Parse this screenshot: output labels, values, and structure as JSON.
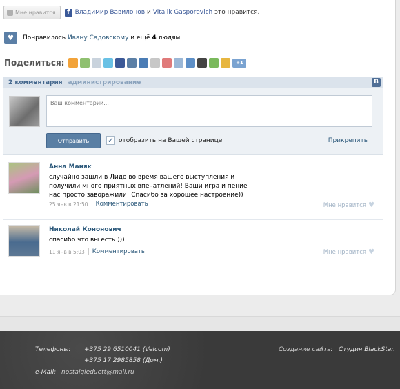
{
  "like_bar": {
    "button_label": "Мне нравится",
    "fb_user1": "Владимир Вавилонов",
    "and": "и",
    "fb_user2": "Vitalik Gasporevich",
    "suffix": "это нравится."
  },
  "vk_like": {
    "prefix": "Понравилось",
    "user": "Ивану Садовскому",
    "middle": "и ещё",
    "count": "4",
    "suffix": "людям"
  },
  "share": {
    "label": "Поделиться:",
    "icons": [
      "rss-icon",
      "share-icon",
      "mail-icon",
      "twitter-icon",
      "facebook-icon",
      "vkontakte-icon",
      "myworld-icon",
      "odnoklassniki-icon",
      "livejournal-icon",
      "liveinternet-icon",
      "mailru-icon",
      "delicious-icon",
      "googlebuzz-icon",
      "windows-live-icon",
      "google-plus-icon"
    ],
    "plus_label": "+1"
  },
  "comments_widget": {
    "count_label": "2 комментария",
    "admin_label": "администрирование",
    "placeholder": "Ваш комментарий...",
    "send_label": "Отправить",
    "checkbox_label": "отобразить на Вашей странице",
    "attach_label": "Прикрепить"
  },
  "comments": [
    {
      "author": "Анна Маняк",
      "text": "случайно зашли в Лидо во время вашего выступления и получили много приятных впечатлений! Ваши игра и пение нас просто заворажили! Спасибо за хорошее настроение))",
      "date": "25 янв в 21:50",
      "reply": "Комментировать",
      "like": "Мне нравится"
    },
    {
      "author": "Николай Кононович",
      "text": "спасибо что вы есть )))",
      "date": "11 янв в 5:03",
      "reply": "Комментировать",
      "like": "Мне нравится"
    }
  ],
  "footer": {
    "phone_label": "Телефоны:",
    "phone1": "+375 29 6510041 (Velcom)",
    "phone2": "+375 17 2985858 (Дом.)",
    "email_label": "e-Mail:",
    "email": "nostalgieduett@mail.ru",
    "site_label": "Создание сайта:",
    "site_value": "Студия BlackStar."
  }
}
